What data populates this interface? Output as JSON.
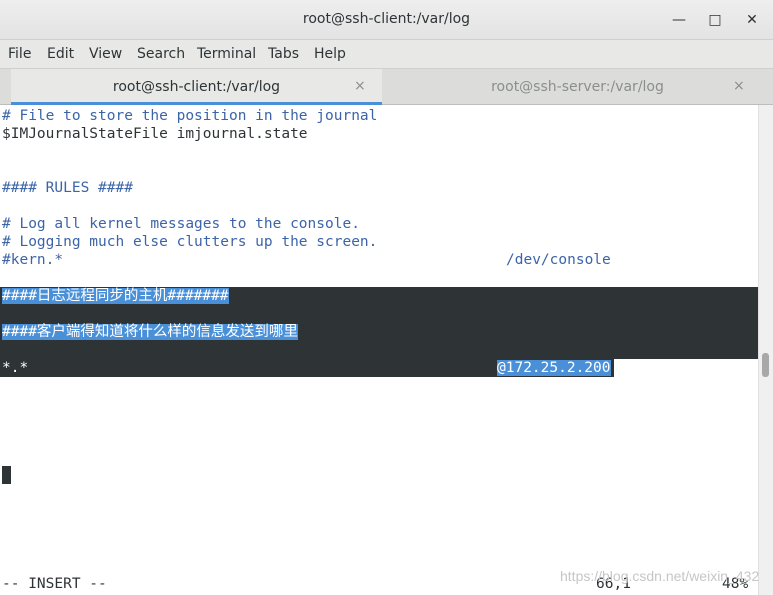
{
  "window": {
    "title": "root@ssh-client:/var/log",
    "minimize_glyph": "—",
    "maximize_glyph": "□",
    "close_glyph": "✕"
  },
  "menu": [
    "File",
    "Edit",
    "View",
    "Search",
    "Terminal",
    "Tabs",
    "Help"
  ],
  "tabs": [
    {
      "label": "root@ssh-client:/var/log",
      "active": true,
      "close": "×"
    },
    {
      "label": "root@ssh-server:/var/log",
      "active": false,
      "close": "×"
    }
  ],
  "lines": [
    "# File to store the position in the journal",
    "$IMJournalStateFile imjournal.state",
    "#### RULES ####",
    "# Log all kernel messages to the console.",
    "# Logging much else clutters up the screen.",
    "#kern.*",
    "/dev/console",
    "####日志远程同步的主机#######",
    "####客户端得知道将什么样的信息发送到哪里",
    "*.*",
    "@172.25.2.200"
  ],
  "status": {
    "mode": "-- INSERT --",
    "position": "66,1",
    "percent": "48%"
  },
  "watermark": "https://blog.csdn.net/weixin_432"
}
